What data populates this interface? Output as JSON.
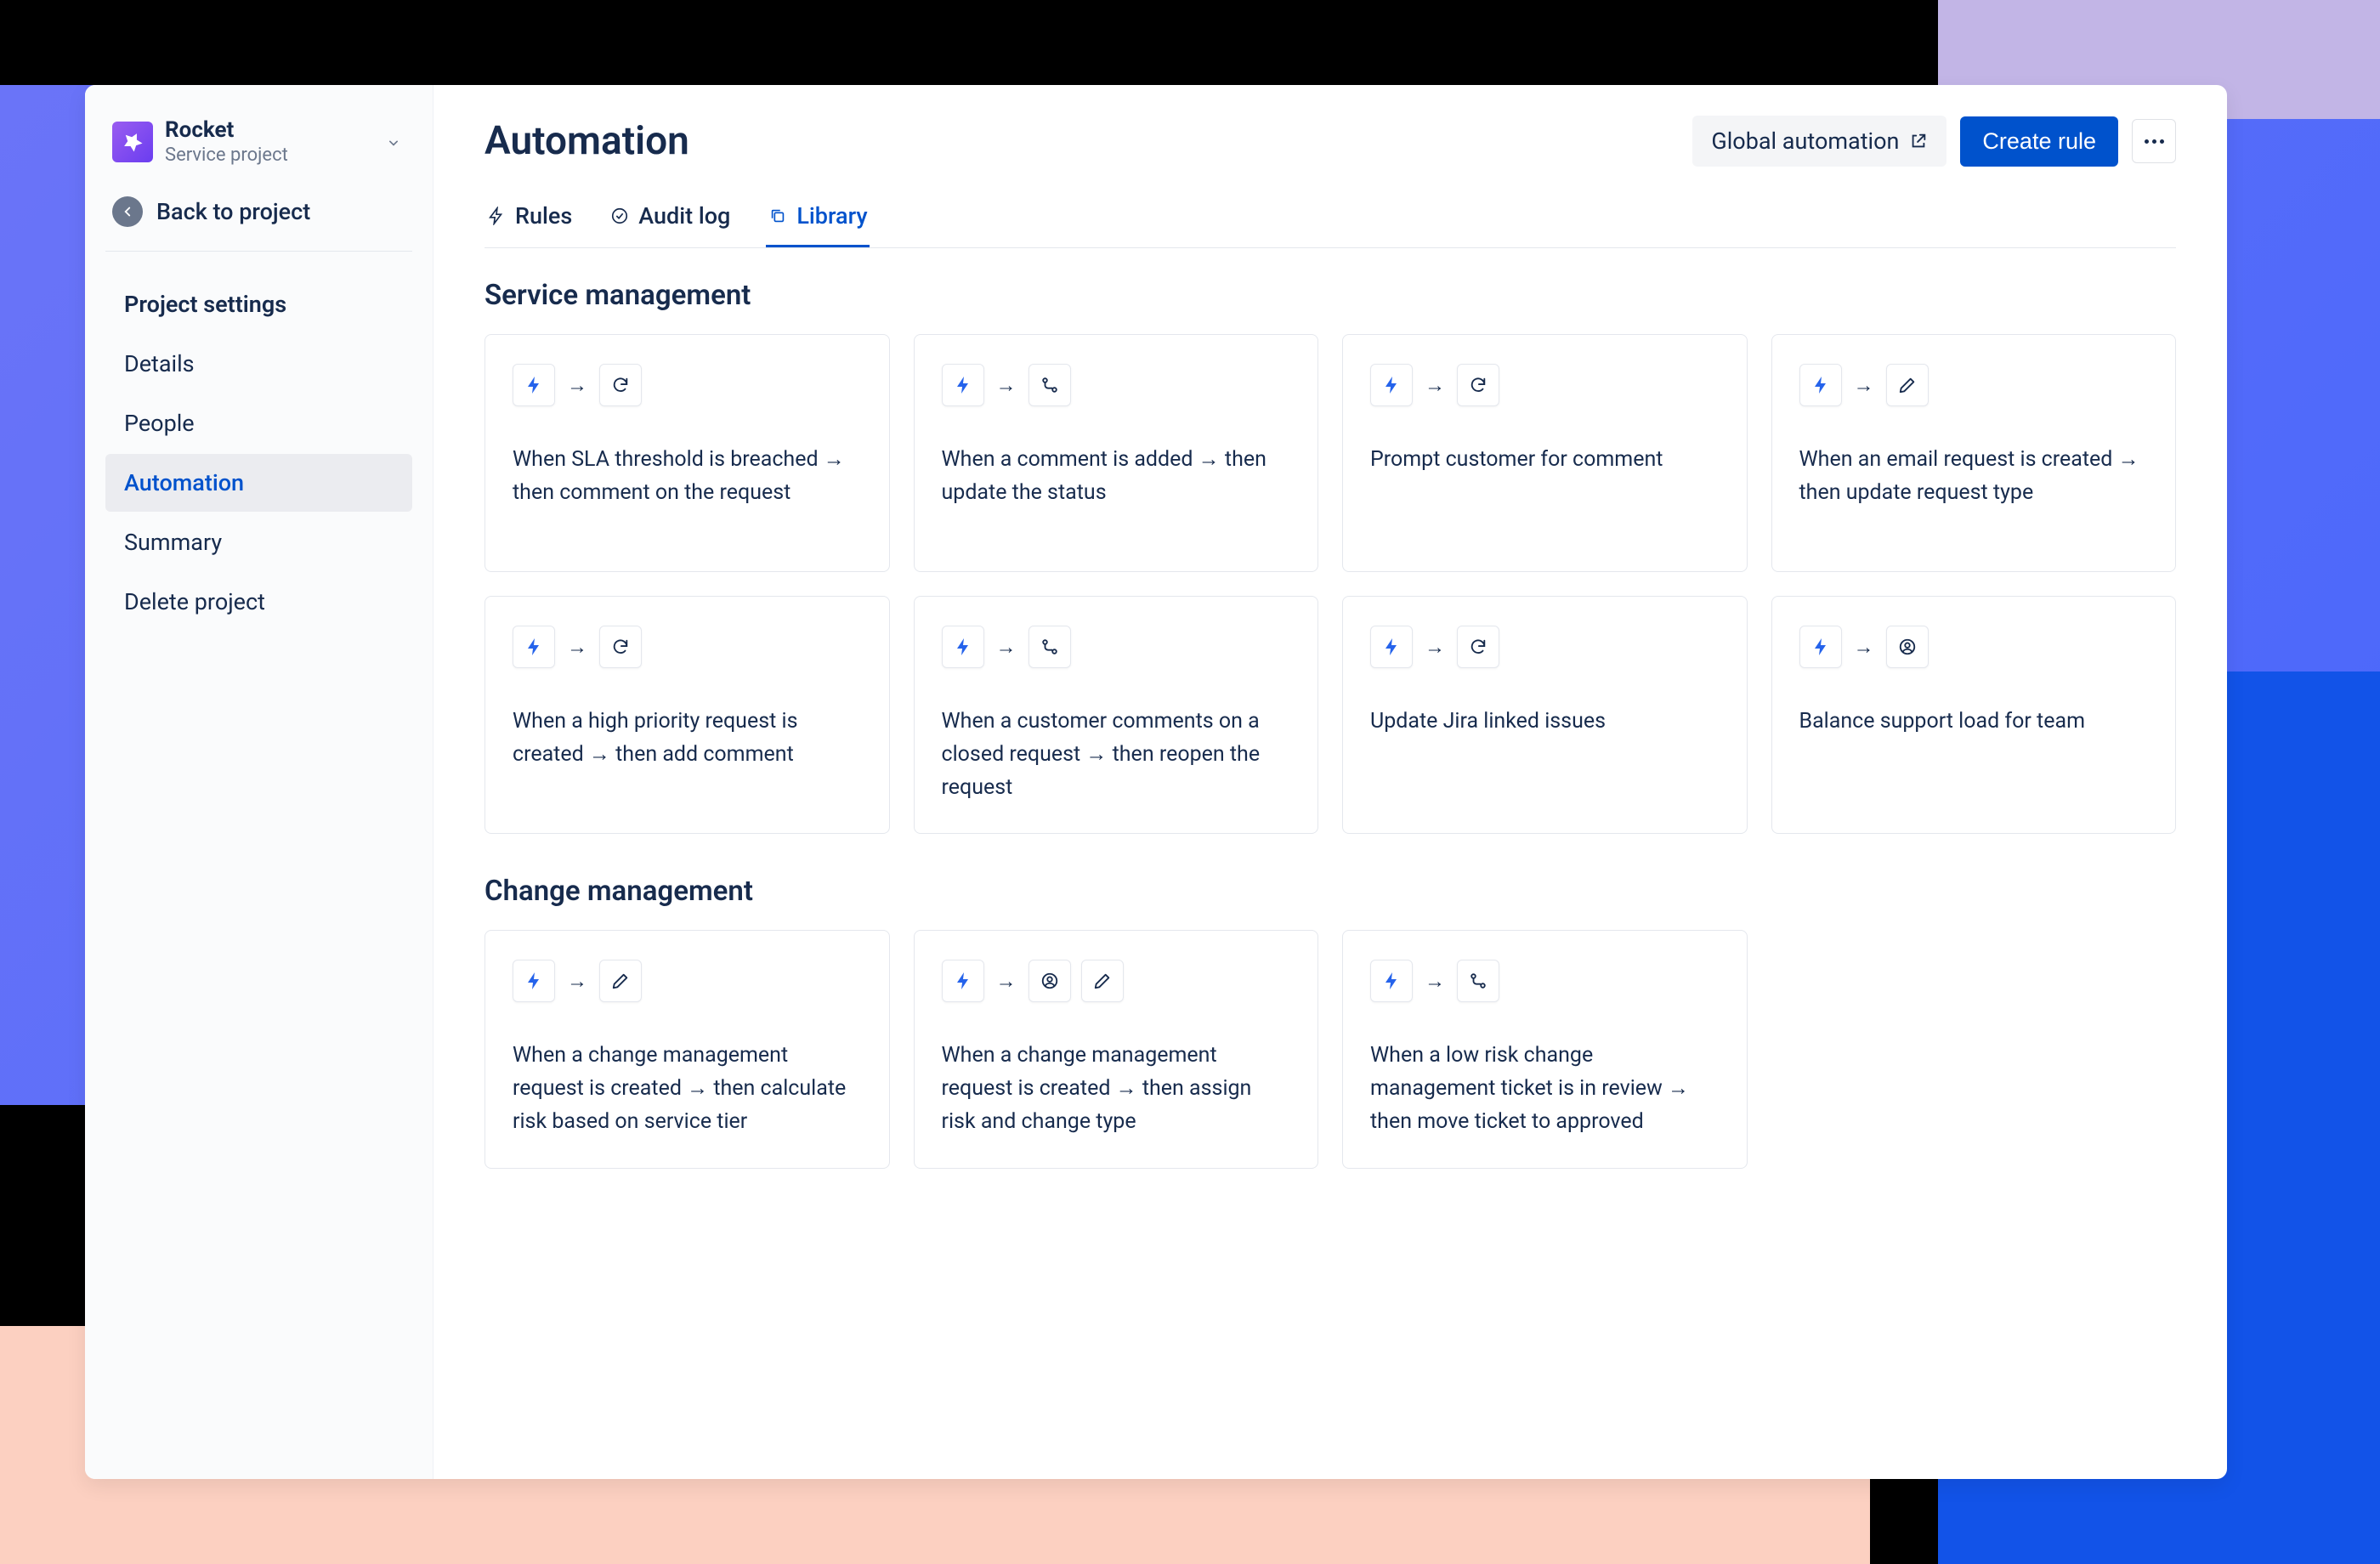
{
  "project": {
    "name": "Rocket",
    "type": "Service project"
  },
  "back_label": "Back to project",
  "sidebar_nav": [
    {
      "label": "Project settings",
      "key": "project-settings"
    },
    {
      "label": "Details",
      "key": "details"
    },
    {
      "label": "People",
      "key": "people"
    },
    {
      "label": "Automation",
      "key": "automation",
      "active": true
    },
    {
      "label": "Summary",
      "key": "summary"
    },
    {
      "label": "Delete project",
      "key": "delete-project"
    }
  ],
  "page": {
    "title": "Automation",
    "global_automation": "Global automation",
    "create_rule": "Create rule"
  },
  "tabs": [
    {
      "label": "Rules",
      "key": "rules",
      "icon": "lightning"
    },
    {
      "label": "Audit log",
      "key": "audit",
      "icon": "check-circle"
    },
    {
      "label": "Library",
      "key": "library",
      "icon": "copy",
      "active": true
    }
  ],
  "sections": [
    {
      "title": "Service management",
      "cards": [
        {
          "text": "When SLA threshold is breached → then comment on the request",
          "actions": [
            "refresh"
          ]
        },
        {
          "text": "When a comment is added → then update the status",
          "actions": [
            "branch"
          ]
        },
        {
          "text": "Prompt customer for comment",
          "actions": [
            "refresh"
          ]
        },
        {
          "text": "When an email request is created → then update request type",
          "actions": [
            "pencil"
          ]
        },
        {
          "text": "When a high priority request is created → then add comment",
          "actions": [
            "refresh"
          ]
        },
        {
          "text": "When a customer comments on a closed request → then reopen the request",
          "actions": [
            "branch"
          ]
        },
        {
          "text": "Update Jira linked issues",
          "actions": [
            "refresh"
          ]
        },
        {
          "text": "Balance support load for team",
          "actions": [
            "person"
          ]
        }
      ]
    },
    {
      "title": "Change management",
      "cards": [
        {
          "text": "When a change management request is created → then calculate risk based on service tier",
          "actions": [
            "pencil"
          ]
        },
        {
          "text": "When a change management request is created → then assign risk and change type",
          "actions": [
            "person",
            "pencil"
          ]
        },
        {
          "text": "When a low risk change management ticket is in review → then move ticket to approved",
          "actions": [
            "branch"
          ]
        }
      ]
    }
  ]
}
